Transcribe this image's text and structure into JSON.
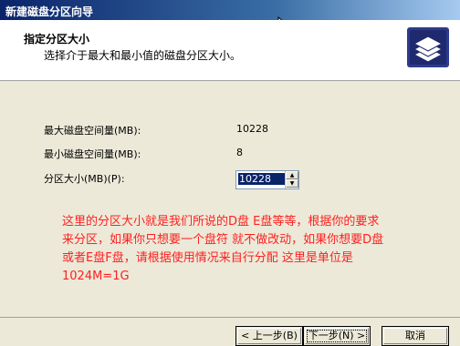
{
  "window": {
    "title": "新建磁盘分区向导"
  },
  "header": {
    "title": "指定分区大小",
    "subtitle": "选择介于最大和最小值的磁盘分区大小。",
    "icon": "disk-stack-icon"
  },
  "fields": {
    "max_label": "最大磁盘空间量(MB):",
    "max_value": "10228",
    "min_label": "最小磁盘空间量(MB):",
    "min_value": "8",
    "size_label": "分区大小(MB)(P):",
    "size_value": "10228"
  },
  "annotation": {
    "lines": [
      "这里的分区大小就是我们所说的D盘 E盘等等，根据你的要求",
      "来分区，如果你只想要一个盘符 就不做改动，如果你想要D盘",
      "或者E盘F盘，请根据使用情况来自行分配   这里是单位是",
      "1024M=1G"
    ],
    "color": "#ff2020"
  },
  "buttons": {
    "back": "< 上一步(B)",
    "next": "下一步(N) >",
    "cancel": "取消"
  },
  "colors": {
    "title_bar": "#0a246a",
    "dialog_bg": "#ece9d8",
    "selection": "#0a246a"
  }
}
